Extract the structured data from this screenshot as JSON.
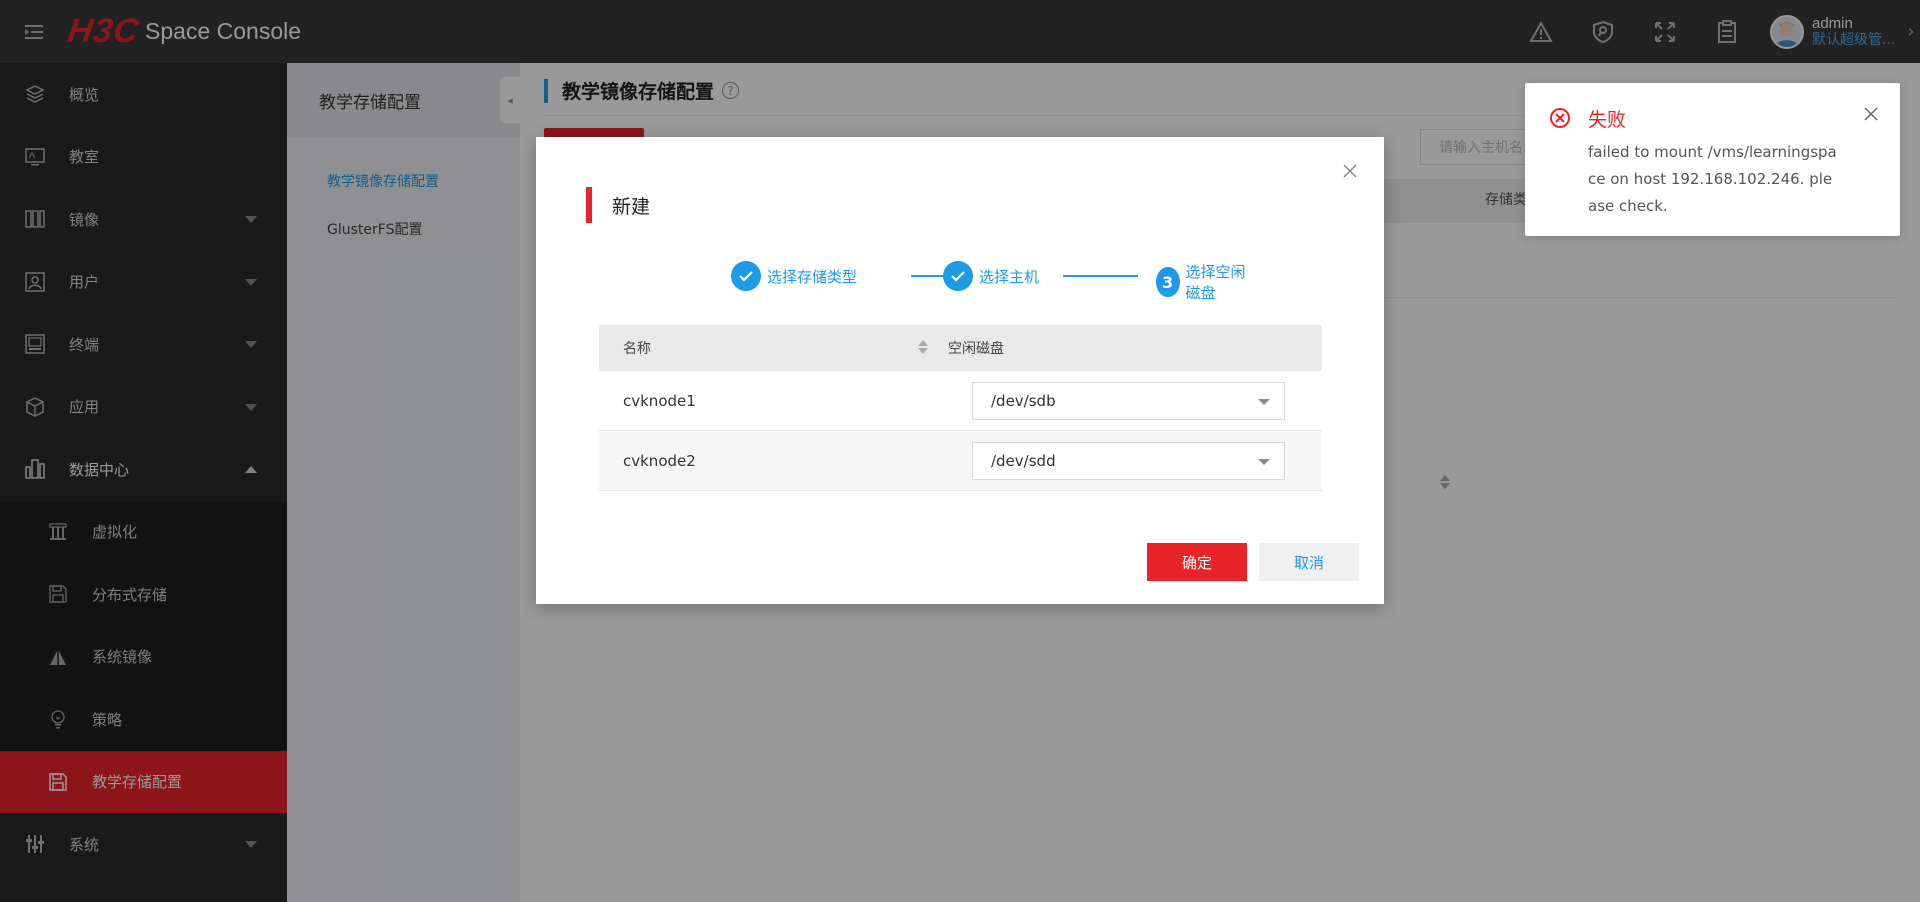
{
  "header": {
    "logo_brand": "H3C",
    "logo_text": "Space Console",
    "user_name": "admin",
    "user_role": "默认超级管..."
  },
  "sidebar": {
    "items": [
      {
        "label": "概览",
        "icon": "layers-icon"
      },
      {
        "label": "教室",
        "icon": "classroom-icon"
      },
      {
        "label": "镜像",
        "icon": "image-icon"
      },
      {
        "label": "用户",
        "icon": "user-icon"
      },
      {
        "label": "终端",
        "icon": "terminal-icon"
      },
      {
        "label": "应用",
        "icon": "app-box-icon"
      },
      {
        "label": "数据中心",
        "icon": "datacenter-icon"
      }
    ],
    "sub_items": [
      {
        "label": "虚拟化",
        "icon": "virtualization-icon"
      },
      {
        "label": "分布式存储",
        "icon": "storage-icon"
      },
      {
        "label": "系统镜像",
        "icon": "triangle-icon"
      },
      {
        "label": "策略",
        "icon": "bulb-icon"
      },
      {
        "label": "教学存储配置",
        "icon": "save-icon"
      }
    ],
    "last_item": {
      "label": "系统",
      "icon": "sliders-icon"
    }
  },
  "panel2": {
    "title": "教学存储配置",
    "items": [
      "教学镜像存储配置",
      "GlusterFS配置"
    ]
  },
  "main": {
    "title": "教学镜像存储配置",
    "search_placeholder": "请输入主机名",
    "bg_column": "存储类"
  },
  "dialog": {
    "title": "新建",
    "steps": [
      {
        "label": "选择存储类型",
        "state": "done"
      },
      {
        "label": "选择主机",
        "state": "done"
      },
      {
        "label": "选择空闲磁盘",
        "state": "current",
        "number": "3"
      }
    ],
    "table": {
      "headers": [
        "名称",
        "空闲磁盘"
      ],
      "rows": [
        {
          "name": "cvknode1",
          "disk": "/dev/sdb"
        },
        {
          "name": "cvknode2",
          "disk": "/dev/sdd"
        }
      ]
    },
    "ok_label": "确定",
    "cancel_label": "取消"
  },
  "notification": {
    "title": "失败",
    "message": "failed to mount /vms/learningspace on host 192.168.102.246. please check."
  },
  "colors": {
    "brand_red": "#e8242a",
    "accent_blue": "#1d9be8",
    "header_bg": "#3a3a3a",
    "sidebar_bg": "#2b2b2b"
  }
}
